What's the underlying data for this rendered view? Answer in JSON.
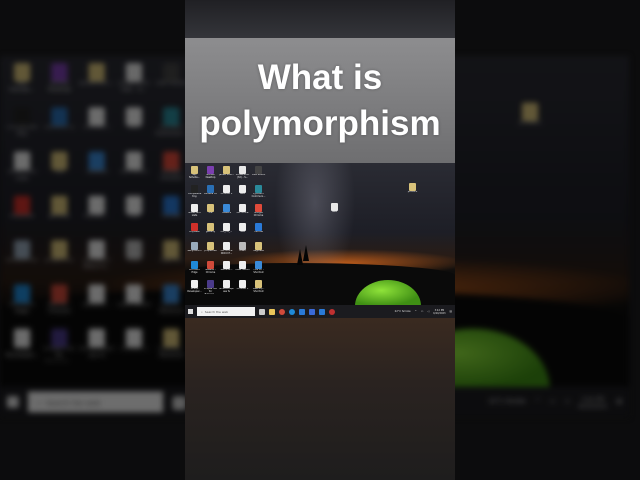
{
  "title": {
    "line1": "What is",
    "line2": "polymorphism"
  },
  "desktop": {
    "icons": [
      [
        "Sql-fullvide...",
        "GitHub Desktop",
        "JavaEFullst...",
        "Screenshot (32) - S...",
        "OBS Studio"
      ],
      [
        "compatible tiny",
        "Camera CE",
        "Untitled 2",
        "New",
        "PyCharm Communi..."
      ],
      [
        "Notes and Lists",
        "file",
        "TAGRES",
        "Esc Office",
        "Google Chrome"
      ],
      [
        "AnyDesk",
        "gensidy",
        "hts_txt_...",
        "new",
        "Vscode"
      ],
      [
        "Recycle Bin",
        "properties",
        "Esc Office DOCX fi...",
        "trash",
        "vaginess"
      ],
      [
        "Microsoft Edge",
        "Nessus - Chrome",
        "sBodine...",
        "class ribbon",
        "This PC - Shortcut"
      ],
      [
        "PLSQL Developer...",
        "Eclipse IDE for Enterpri...",
        "differenceph ass fs",
        "Untitled 1",
        "Desktop - Shortcut"
      ]
    ],
    "icon_colors": [
      [
        "#d8c27a",
        "#7b3fb0",
        "#d8c27a",
        "#e8e8e8",
        "#444"
      ],
      [
        "#222",
        "#2a6fb5",
        "#eee",
        "#eee",
        "#2a8a9a"
      ],
      [
        "#eee",
        "#d8c27a",
        "#3a8ad8",
        "#eee",
        "#e04a3a"
      ],
      [
        "#d0302a",
        "#d8c27a",
        "#eee",
        "#eee",
        "#2a7ad8"
      ],
      [
        "#9ab",
        "#d8c27a",
        "#eee",
        "#bbb",
        "#d8c27a"
      ],
      [
        "#1f8ad8",
        "#d04a3a",
        "#eee",
        "#eee",
        "#3a8ad8"
      ],
      [
        "#eee",
        "#4a3a8a",
        "#eee",
        "#eee",
        "#d8c27a"
      ]
    ],
    "extra_icons": [
      {
        "label": "ph.docx",
        "color": "#d8c27a"
      },
      {
        "label": "New",
        "color": "#e8e8e8"
      }
    ],
    "taskbar": {
      "search_placeholder": "Search the web",
      "weather": "22°C Smoke",
      "time": "3:42 PM",
      "date": "6/20/2023"
    }
  }
}
